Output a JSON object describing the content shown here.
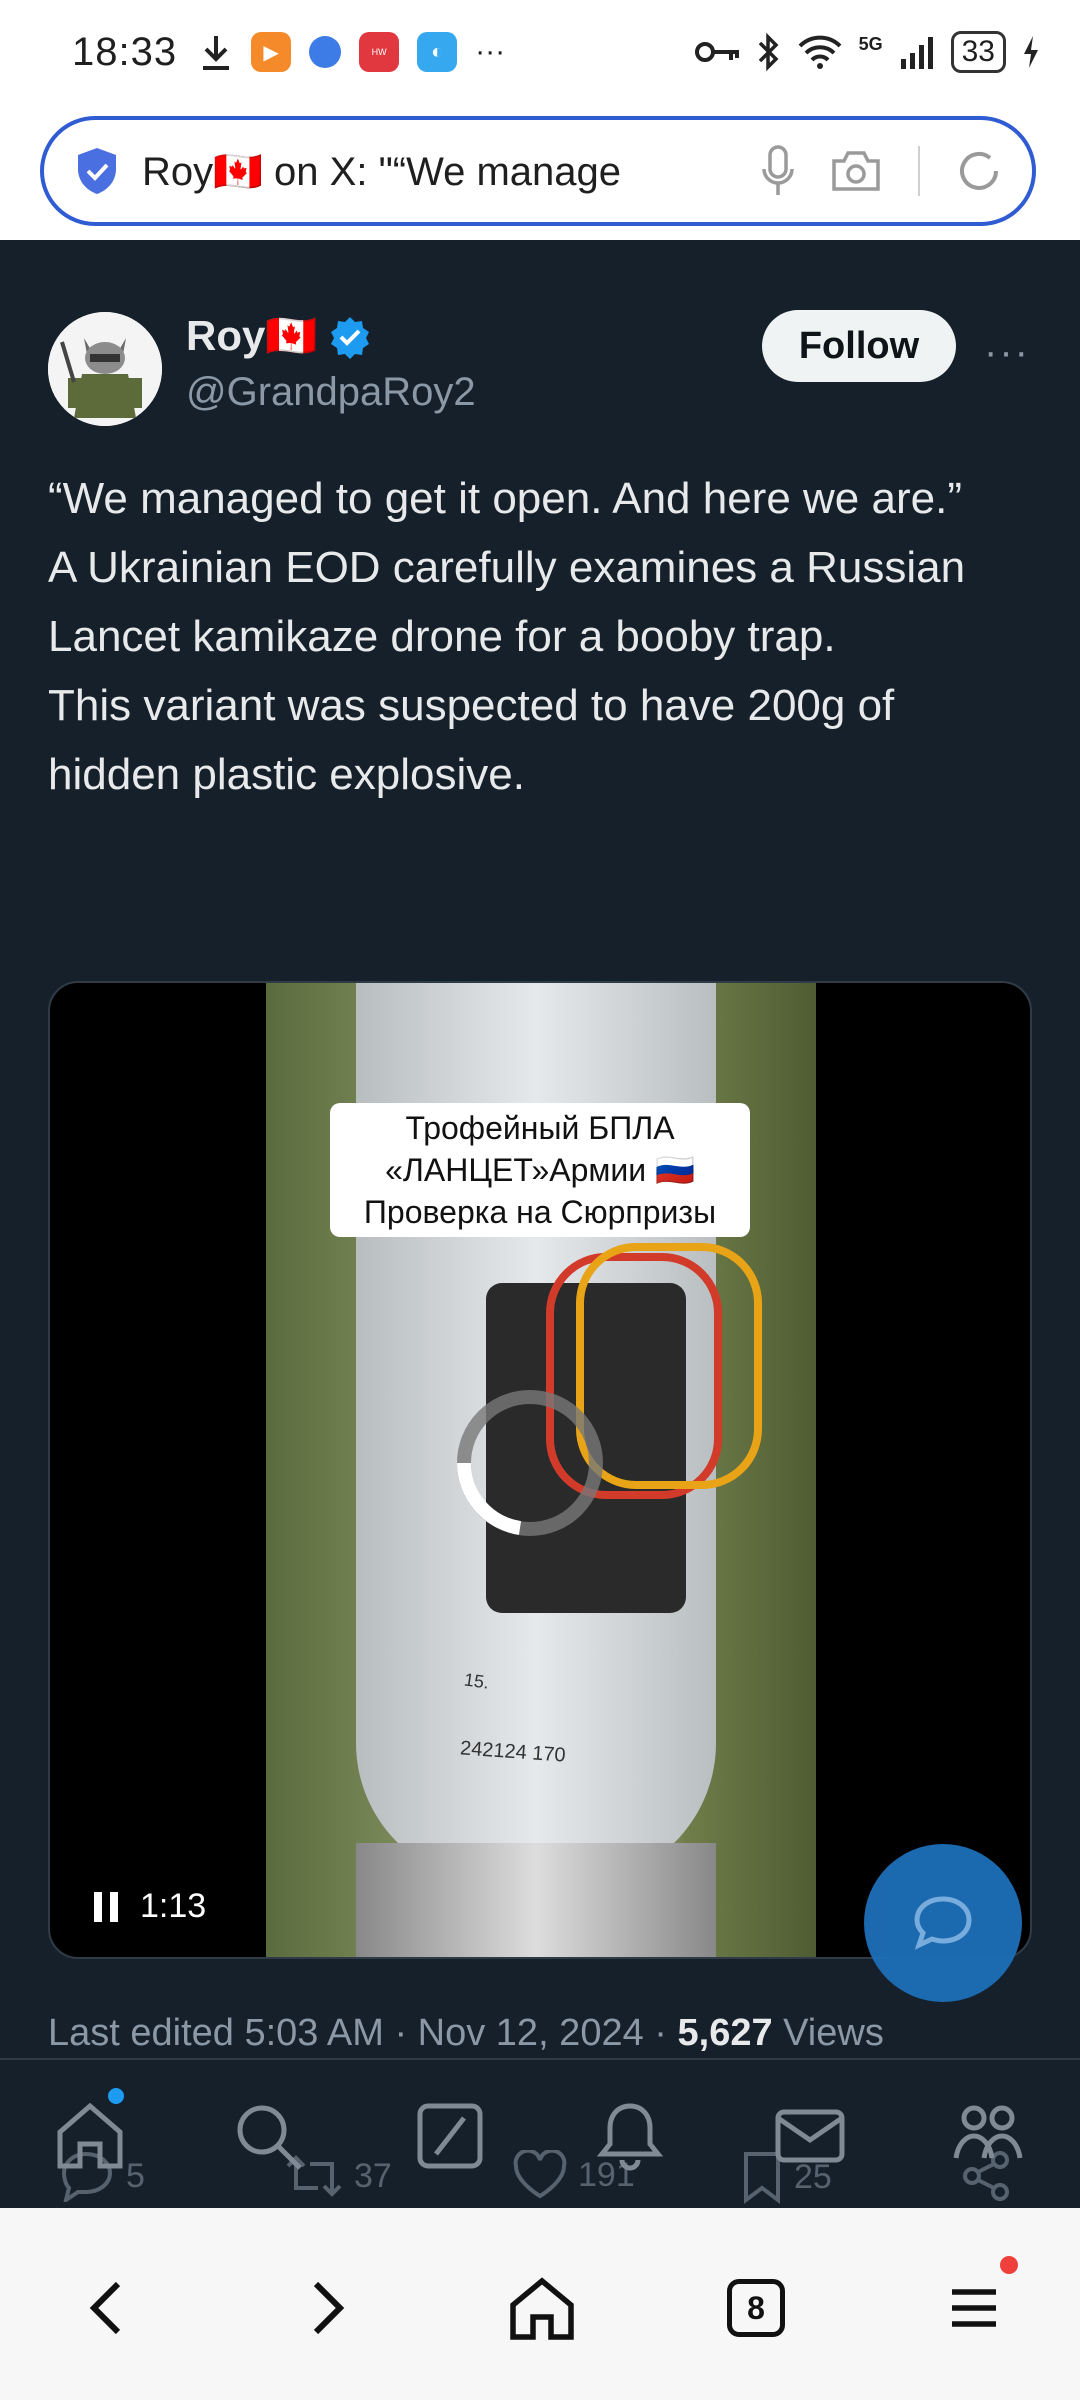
{
  "status_bar": {
    "time": "18:33",
    "network": "5G",
    "battery": "33",
    "app_badges": [
      "download-icon",
      "play-app-icon",
      "browser-app-icon",
      "huawei-app-icon",
      "gallery-app-icon"
    ],
    "more": "···"
  },
  "browser": {
    "url_text": "Roy🇨🇦 on X: \"“We manage",
    "tabs_count": "8"
  },
  "tweet": {
    "name": "Roy🇨🇦",
    "handle": "@GrandpaRoy2",
    "follow_label": "Follow",
    "more_label": "···",
    "text_lines": [
      "“We managed to get it open. And here we are.”",
      "A Ukrainian EOD carefully examines a Russian Lancet kamikaze drone for a booby trap.",
      "This variant was suspected to have 200g of hidden plastic explosive."
    ],
    "video": {
      "overlay_lines": [
        "Трофейный БПЛА",
        "«ЛАНЦЕТ»Армии 🇷🇺",
        "Проверка на Сюрпризы"
      ],
      "marking_1": "15.",
      "marking_2": "242124 170",
      "time": "1:13"
    },
    "meta": {
      "edited": "Last edited 5:03 AM · Nov 12, 2024 · ",
      "views_count": "5,627",
      "views_label": " Views"
    },
    "engagement": {
      "replies": "5",
      "reposts": "37",
      "likes": "191",
      "bookmarks": "25"
    }
  },
  "colors": {
    "background": "#15202b",
    "accent": "#1d9bf0",
    "url_border": "#2f5bd3"
  }
}
